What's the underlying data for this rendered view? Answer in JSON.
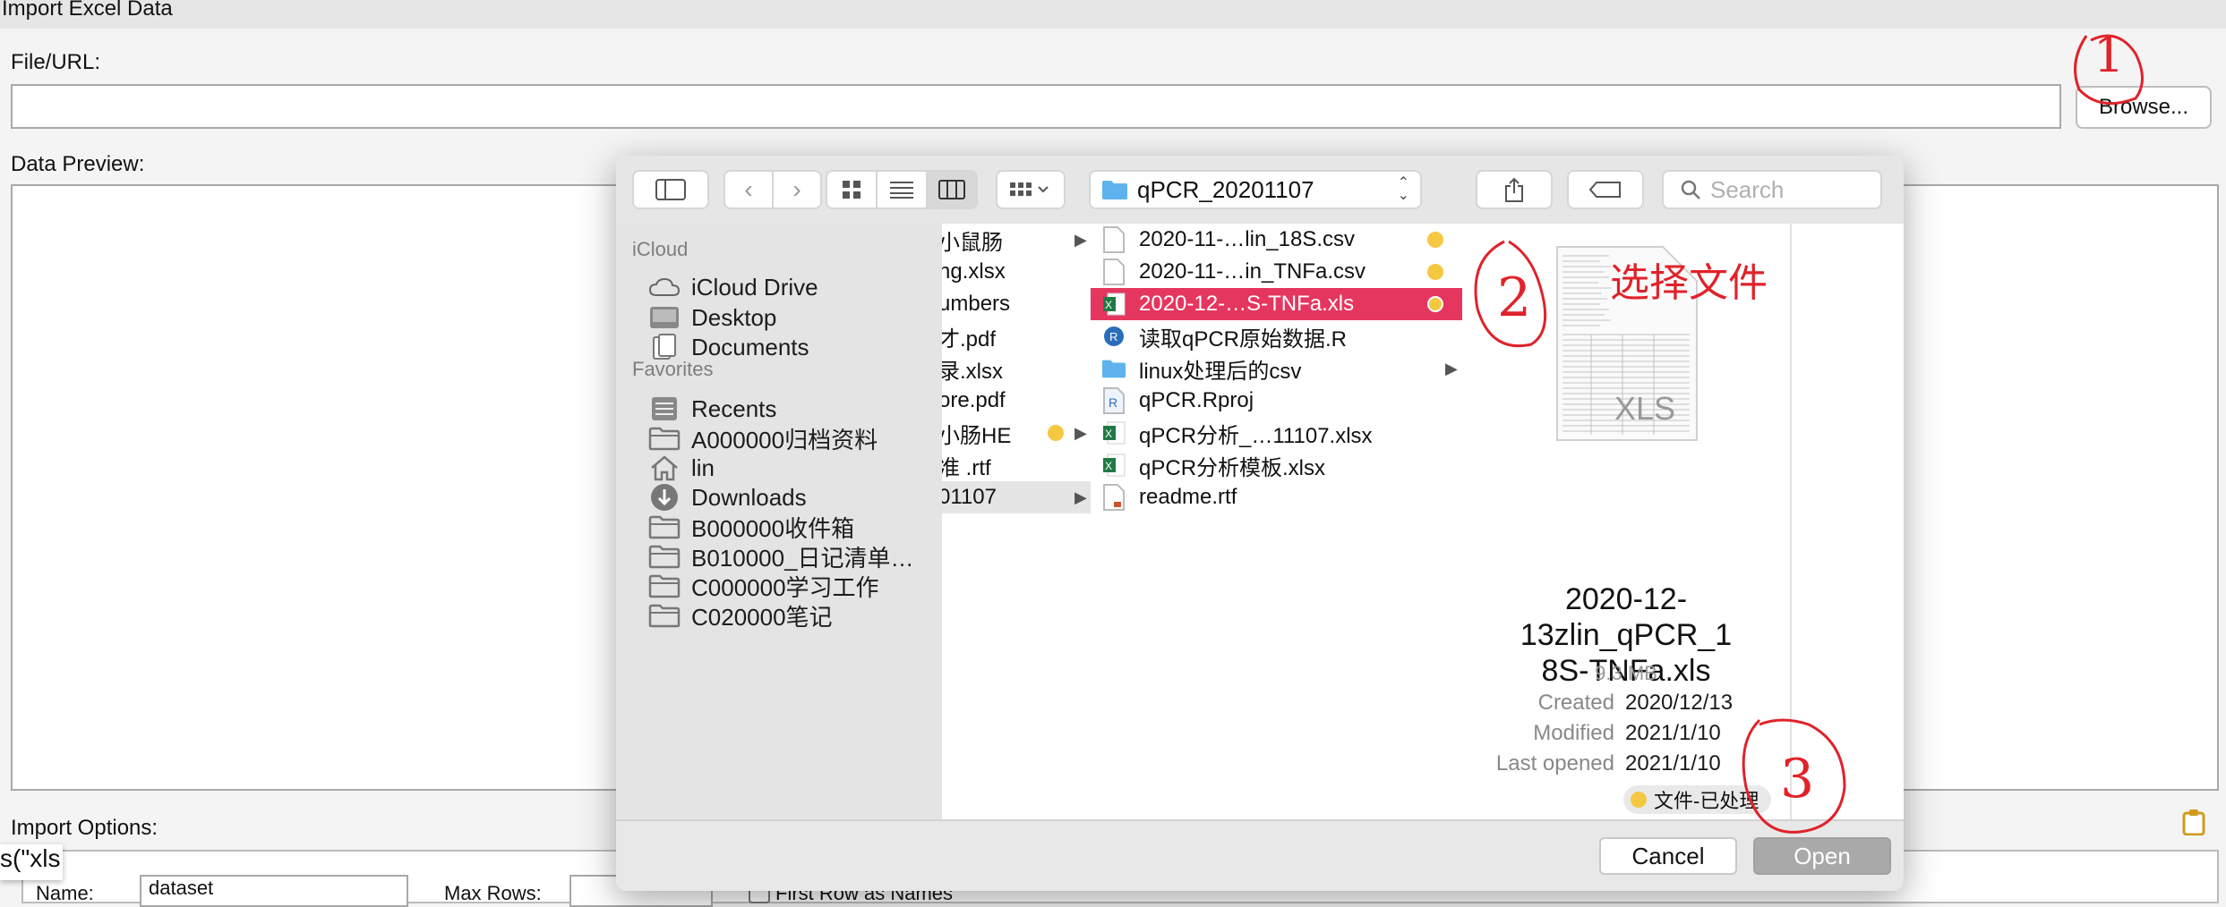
{
  "window": {
    "title": "Import Excel Data"
  },
  "file_url": {
    "label": "File/URL:",
    "value": "",
    "browse": "Browse..."
  },
  "preview": {
    "label": "Data Preview:"
  },
  "import_options": {
    "label": "Import Options:",
    "name_label": "Name:",
    "name_value": "dataset",
    "max_rows_label": "Max Rows:",
    "first_row_label": "First Row as Names",
    "code_fragment": "s(\"xls"
  },
  "dialog": {
    "location": "qPCR_20201107",
    "search_placeholder": "Search",
    "sidebar": {
      "icloud_header": "iCloud",
      "icloud_items": [
        {
          "label": "iCloud Drive",
          "icon": "cloud-icon"
        },
        {
          "label": "Desktop",
          "icon": "desktop-icon"
        },
        {
          "label": "Documents",
          "icon": "document-icon"
        }
      ],
      "favorites_header": "Favorites",
      "favorites_items": [
        {
          "label": "Recents",
          "icon": "recents-icon"
        },
        {
          "label": "A000000归档资料",
          "icon": "folder-icon"
        },
        {
          "label": "lin",
          "icon": "home-icon"
        },
        {
          "label": "Downloads",
          "icon": "downloads-icon"
        },
        {
          "label": "B000000收件箱",
          "icon": "folder-icon"
        },
        {
          "label": "B010000_日记清单…",
          "icon": "folder-icon"
        },
        {
          "label": "C000000学习工作",
          "icon": "folder-icon"
        },
        {
          "label": "C020000笔记",
          "icon": "folder-icon"
        }
      ]
    },
    "column1": [
      {
        "label": "小鼠肠",
        "chevron": true
      },
      {
        "label": "ng.xlsx"
      },
      {
        "label": "umbers"
      },
      {
        "label": "才.pdf"
      },
      {
        "label": "录.xlsx"
      },
      {
        "label": "ore.pdf"
      },
      {
        "label": "小肠HE",
        "chevron": true,
        "tag": true
      },
      {
        "label": "准 .rtf"
      },
      {
        "label": "01107",
        "chevron": true,
        "selected": true
      }
    ],
    "column2": [
      {
        "label": "2020-11-…lin_18S.csv",
        "icon": "csv-file-icon",
        "tag": true
      },
      {
        "label": "2020-11-…in_TNFa.csv",
        "icon": "csv-file-icon",
        "tag": true
      },
      {
        "label": "2020-12-…S-TNFa.xls",
        "icon": "excel-file-icon",
        "tag": true,
        "highlighted": true
      },
      {
        "label": "读取qPCR原始数据.R",
        "icon": "r-script-icon"
      },
      {
        "label": "linux处理后的csv",
        "icon": "folder-icon",
        "chevron": true
      },
      {
        "label": "qPCR.Rproj",
        "icon": "rproj-icon"
      },
      {
        "label": "qPCR分析_…11107.xlsx",
        "icon": "excel-file-icon"
      },
      {
        "label": "qPCR分析模板.xlsx",
        "icon": "excel-file-icon"
      },
      {
        "label": "readme.rtf",
        "icon": "rtf-file-icon"
      }
    ],
    "preview": {
      "thumb_label": "XLS",
      "filename_line1": "2020-12-13zlin_qPCR_1",
      "filename_line2": "8S-TNFa.xls",
      "size": "9.3 MB",
      "created_label": "Created",
      "created": "2020/12/13",
      "modified_label": "Modified",
      "modified": "2021/1/10",
      "last_opened_label": "Last opened",
      "last_opened": "2021/1/10",
      "tag": "文件-已处理"
    },
    "cancel": "Cancel",
    "open": "Open"
  },
  "annotations": {
    "step1": "1",
    "step2": "2",
    "step3": "3",
    "choose_file": "选择文件"
  },
  "colors": {
    "selection": "#e5365f",
    "tag": "#f5c842",
    "annotation": "#e0222a",
    "folder": "#5eb3ee"
  }
}
